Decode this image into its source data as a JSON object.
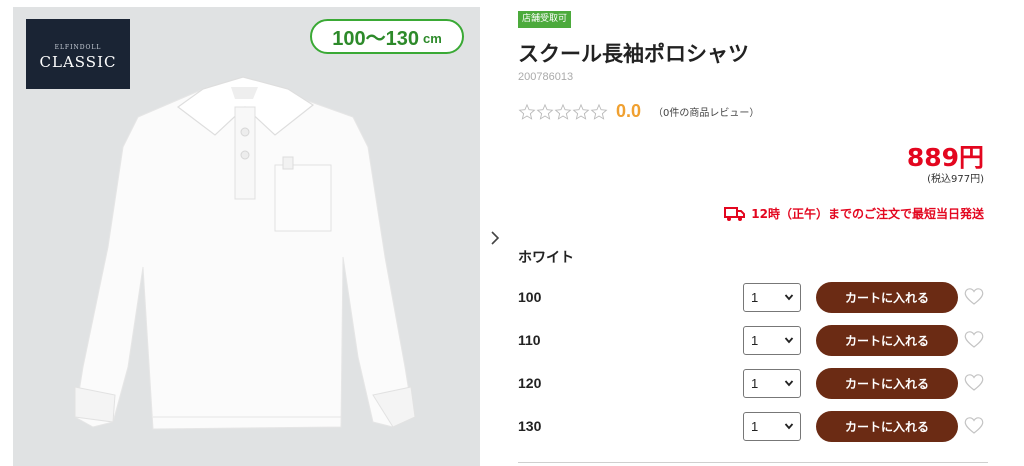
{
  "gallery": {
    "brand_logo": {
      "sub": "ELFINDOLL",
      "main": "CLASSIC"
    },
    "size_badge": {
      "range": "100～130",
      "unit": "cm"
    },
    "next_icon": "chevron-right-icon"
  },
  "product": {
    "store_badge": "店舗受取可",
    "title": "スクール長袖ポロシャツ",
    "code": "200786013",
    "rating": {
      "value": "0.0",
      "stars_filled": 0,
      "stars_total": 5,
      "review_link": "（0件の商品レビュー）"
    },
    "price": "889円",
    "tax_price": "(税込977円)",
    "shipping_note": "12時（正午）までのご注文で最短当日発送",
    "color_name": "ホワイト",
    "sizes": [
      {
        "size": "100",
        "qty": "1",
        "cart_label": "カートに入れる"
      },
      {
        "size": "110",
        "qty": "1",
        "cart_label": "カートに入れる"
      },
      {
        "size": "120",
        "qty": "1",
        "cart_label": "カートに入れる"
      },
      {
        "size": "130",
        "qty": "1",
        "cart_label": "カートに入れる"
      }
    ]
  },
  "colors": {
    "price_red": "#e3061f",
    "cart_button": "#6b2b14",
    "badge_green": "#4caa3c",
    "rating_orange": "#f0a030"
  }
}
